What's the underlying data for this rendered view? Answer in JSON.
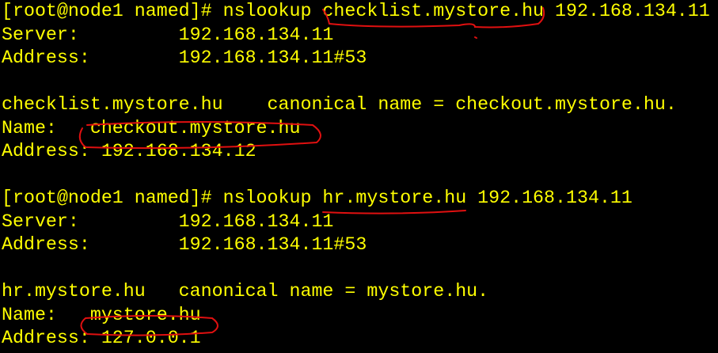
{
  "terminal": {
    "text_color": "#ffff00",
    "background": "#000000",
    "annotation_color": "#e01010",
    "lines": [
      "[root@node1 named]# nslookup checklist.mystore.hu 192.168.134.11",
      "Server:         192.168.134.11",
      "Address:        192.168.134.11#53",
      "",
      "checklist.mystore.hu    canonical name = checkout.mystore.hu.",
      "Name:   checkout.mystore.hu",
      "Address: 192.168.134.12",
      "",
      "[root@node1 named]# nslookup hr.mystore.hu 192.168.134.11",
      "Server:         192.168.134.11",
      "Address:        192.168.134.11#53",
      "",
      "hr.mystore.hu   canonical name = mystore.hu.",
      "Name:   mystore.hu",
      "Address: 127.0.0.1"
    ]
  }
}
